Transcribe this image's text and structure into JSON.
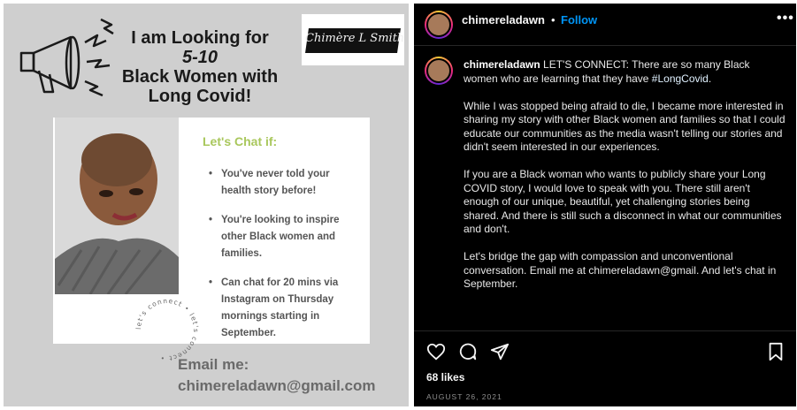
{
  "flyer": {
    "headline_1": "I am Looking for",
    "headline_2": "5-10",
    "headline_3": "Black Women with",
    "headline_4": "Long Covid!",
    "signature": "Chimère L Smith",
    "card_title": "Let's Chat if:",
    "bullets": [
      "You've never told your health story before!",
      "You're looking to inspire other Black women and families.",
      "Can chat for 20 mins via Instagram on Thursday mornings starting in September."
    ],
    "ring_text": "let's connect • let's connect •",
    "email_label": "Email me:",
    "email_value": "chimereladawn@gmail.com",
    "accent_color": "#a9c75c"
  },
  "post": {
    "username": "chimereladawn",
    "dot": "•",
    "follow": "Follow",
    "more": "•••",
    "caption_user": "chimereladawn",
    "caption_intro": " LET'S CONNECT: There are so many Black women who are learning that they have ",
    "hashtag": "#LongCovid",
    "caption_intro_end": ".",
    "paragraphs": [
      "While I was stopped being afraid to die, I became more interested in sharing my story with other Black women and families so that I could educate our communities as the media wasn't telling our stories and didn't seem interested in our experiences.",
      "If you are a Black woman who wants to publicly share your Long COVID story, I would love to speak with you. There still aren't enough of our unique, beautiful, yet challenging stories being shared. And there is still such a disconnect in what our communities and don't.",
      "Let's bridge the gap with compassion and unconventional conversation. Email me at chimereladawn@gmail. And let's chat in September."
    ],
    "likes": "68 likes",
    "date": "AUGUST 26, 2021",
    "icons": [
      "heart-icon",
      "comment-icon",
      "share-icon",
      "bookmark-icon"
    ],
    "follow_color": "#0095f6"
  }
}
